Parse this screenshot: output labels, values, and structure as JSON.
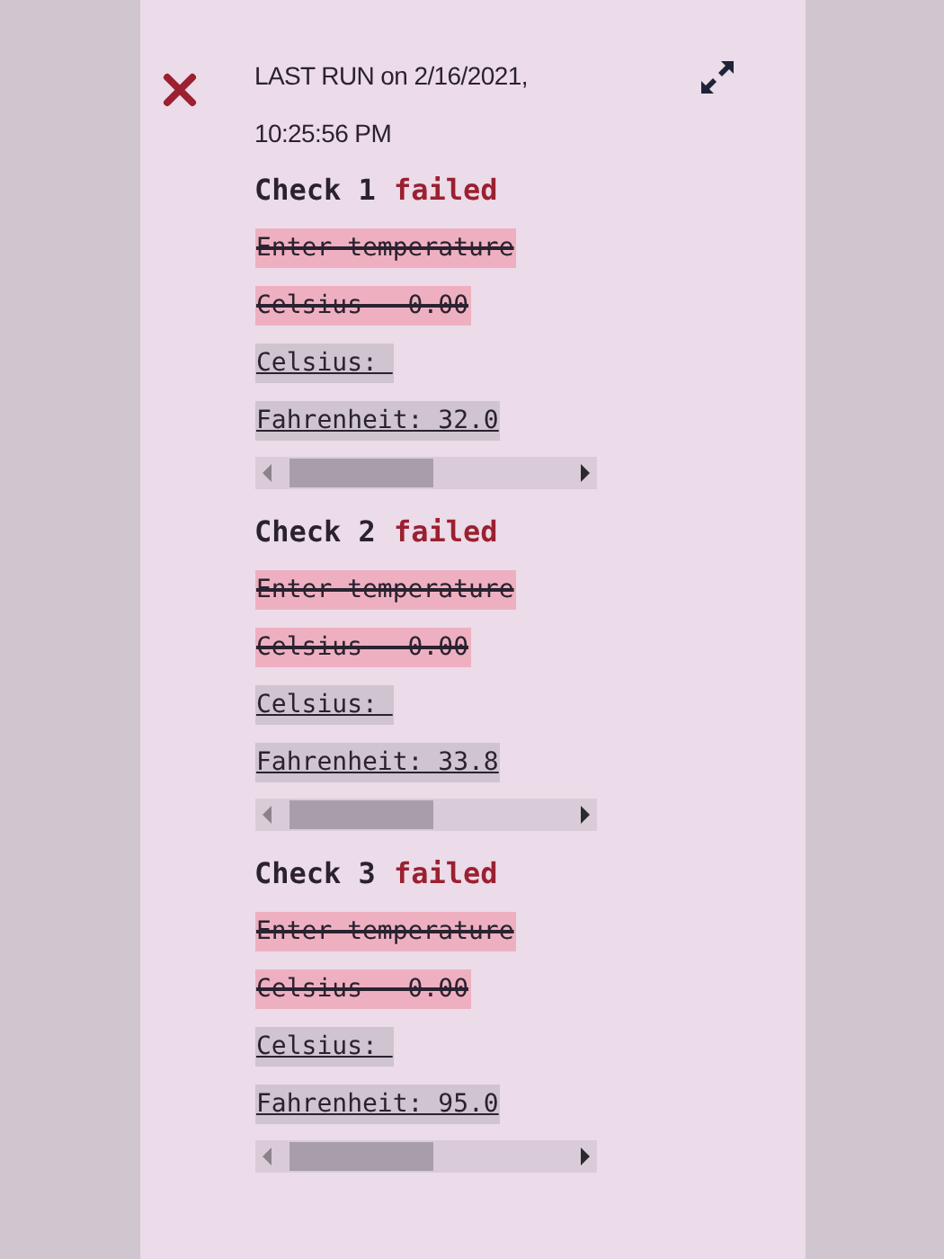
{
  "run": {
    "failed": true,
    "text": "LAST RUN on 2/16/2021, 10:25:56 PM"
  },
  "checks": [
    {
      "title": "Check 1",
      "status": "failed",
      "lines": [
        {
          "kind": "removed",
          "text": "Enter temperature"
        },
        {
          "kind": "removed",
          "text": "Celsius - 0.00"
        },
        {
          "kind": "added",
          "text": "Celsius: "
        },
        {
          "kind": "added",
          "text": "Fahrenheit: 32.0"
        }
      ]
    },
    {
      "title": "Check 2",
      "status": "failed",
      "lines": [
        {
          "kind": "removed",
          "text": "Enter temperature"
        },
        {
          "kind": "removed",
          "text": "Celsius - 0.00"
        },
        {
          "kind": "added",
          "text": "Celsius: "
        },
        {
          "kind": "added",
          "text": "Fahrenheit: 33.8"
        }
      ]
    },
    {
      "title": "Check 3",
      "status": "failed",
      "lines": [
        {
          "kind": "removed",
          "text": "Enter temperature"
        },
        {
          "kind": "removed",
          "text": "Celsius - 0.00"
        },
        {
          "kind": "added",
          "text": "Celsius: "
        },
        {
          "kind": "added",
          "text": "Fahrenheit: 95.0"
        }
      ]
    }
  ]
}
